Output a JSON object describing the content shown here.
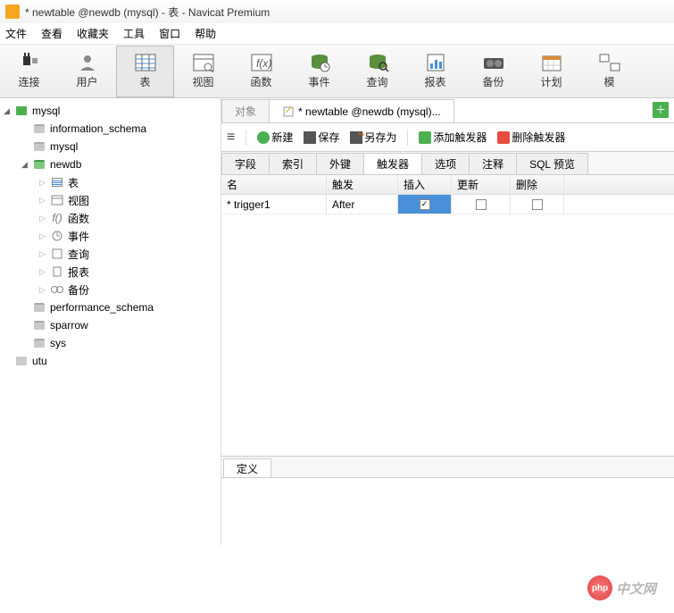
{
  "window": {
    "title": "* newtable @newdb (mysql) - 表 - Navicat Premium"
  },
  "menu": [
    "文件",
    "查看",
    "收藏夹",
    "工具",
    "窗口",
    "帮助"
  ],
  "toolbar": [
    {
      "label": "连接",
      "icon": "plug",
      "active": false
    },
    {
      "label": "用户",
      "icon": "user",
      "active": false
    },
    {
      "label": "表",
      "icon": "table",
      "active": true
    },
    {
      "label": "视图",
      "icon": "view",
      "active": false
    },
    {
      "label": "函数",
      "icon": "fx",
      "active": false
    },
    {
      "label": "事件",
      "icon": "event",
      "active": false
    },
    {
      "label": "查询",
      "icon": "query",
      "active": false
    },
    {
      "label": "报表",
      "icon": "report",
      "active": false
    },
    {
      "label": "备份",
      "icon": "backup",
      "active": false
    },
    {
      "label": "计划",
      "icon": "schedule",
      "active": false
    },
    {
      "label": "模",
      "icon": "model",
      "active": false
    }
  ],
  "tree": {
    "servers": [
      {
        "name": "mysql",
        "expanded": true,
        "icon": "server-green",
        "children": [
          {
            "name": "information_schema",
            "type": "db"
          },
          {
            "name": "mysql",
            "type": "db"
          },
          {
            "name": "newdb",
            "type": "db",
            "expanded": true,
            "children": [
              {
                "name": "表",
                "icon": "table"
              },
              {
                "name": "视图",
                "icon": "view"
              },
              {
                "name": "函数",
                "icon": "fx"
              },
              {
                "name": "事件",
                "icon": "event"
              },
              {
                "name": "查询",
                "icon": "query"
              },
              {
                "name": "报表",
                "icon": "report"
              },
              {
                "name": "备份",
                "icon": "backup"
              }
            ]
          },
          {
            "name": "performance_schema",
            "type": "db"
          },
          {
            "name": "sparrow",
            "type": "db"
          },
          {
            "name": "sys",
            "type": "db"
          }
        ]
      },
      {
        "name": "utu",
        "expanded": false,
        "icon": "server-grey"
      }
    ]
  },
  "main_tabs": [
    {
      "label": "对象",
      "active": false
    },
    {
      "label": "* newtable @newdb (mysql)...",
      "active": true
    }
  ],
  "actions": {
    "new": "新建",
    "save": "保存",
    "save_as": "另存为",
    "add_trigger": "添加触发器",
    "del_trigger": "删除触发器"
  },
  "subtabs": [
    "字段",
    "索引",
    "外键",
    "触发器",
    "选项",
    "注释",
    "SQL 预览"
  ],
  "subtab_active": 3,
  "grid": {
    "headers": [
      "名",
      "触发",
      "插入",
      "更新",
      "删除"
    ],
    "rows": [
      {
        "name": "* trigger1",
        "trigger": "After",
        "insert": true,
        "update": false,
        "delete": false,
        "selected_col": 2
      }
    ]
  },
  "bottom_tab": "定义",
  "watermark": "中文网"
}
